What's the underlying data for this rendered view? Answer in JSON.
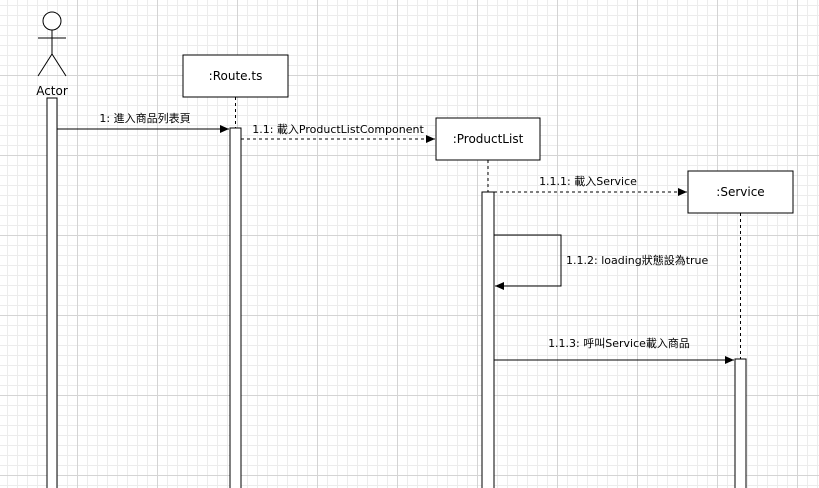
{
  "actor": {
    "label": "Actor"
  },
  "participants": [
    {
      "id": "route",
      "label": ":Route.ts"
    },
    {
      "id": "productlist",
      "label": ":ProductList"
    },
    {
      "id": "service",
      "label": ":Service"
    }
  ],
  "messages": [
    {
      "id": "m1",
      "label": "1: 進入商品列表頁",
      "style": "solid"
    },
    {
      "id": "m11",
      "label": "1.1: 載入ProductListComponent",
      "style": "dashed"
    },
    {
      "id": "m111",
      "label": "1.1.1: 載入Service",
      "style": "dashed"
    },
    {
      "id": "m112",
      "label": "1.1.2: loading狀態設為true",
      "style": "solid"
    },
    {
      "id": "m113",
      "label": "1.1.3: 呼叫Service載入商品",
      "style": "solid"
    }
  ]
}
